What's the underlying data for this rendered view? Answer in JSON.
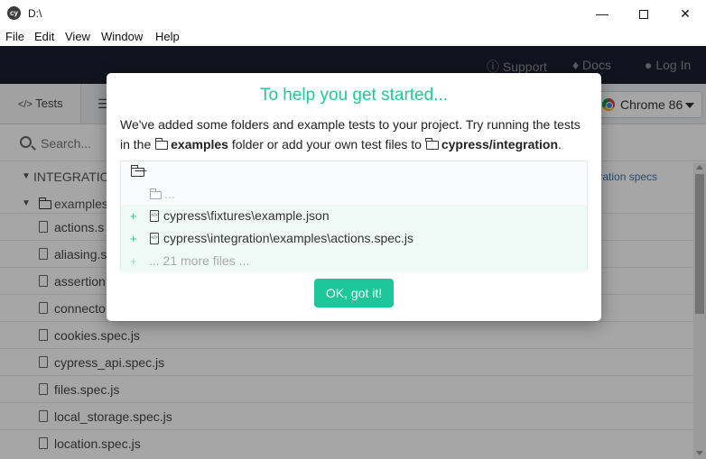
{
  "window": {
    "title": "D:\\",
    "logo_text": "cy",
    "min_glyph": "—",
    "close_glyph": "✕"
  },
  "menu": [
    "File",
    "Edit",
    "View",
    "Window",
    "Help"
  ],
  "topnav": {
    "support": "Support",
    "docs": "Docs",
    "login": "Log In"
  },
  "tabs": {
    "tests": "Tests",
    "tests_glyph": "</>",
    "runs_glyph": "☰",
    "browser": "Chrome 86"
  },
  "search": {
    "placeholder": "Search..."
  },
  "spec_list": {
    "folder_root": "INTEGRATION",
    "run_all_label": "egration specs",
    "folder_examples": "examples",
    "specs": [
      "actions.s",
      "aliasing.s",
      "assertion",
      "connecto",
      "cookies.spec.js",
      "cypress_api.spec.js",
      "files.spec.js",
      "local_storage.spec.js",
      "location.spec.js"
    ]
  },
  "modal": {
    "title": "To help you get started...",
    "text_1": "We've added some folders and example tests to your project. Try running the tests in the ",
    "folder_1": "examples",
    "text_2": " folder or add your own test files to ",
    "folder_2": "cypress/integration",
    "text_3": ".",
    "tree": {
      "dots": "...",
      "plus": "+",
      "new_files": [
        "cypress\\fixtures\\example.json",
        "cypress\\integration\\examples\\actions.spec.js"
      ],
      "more": "... 21 more files ..."
    },
    "ok_button": "OK, got it!"
  }
}
